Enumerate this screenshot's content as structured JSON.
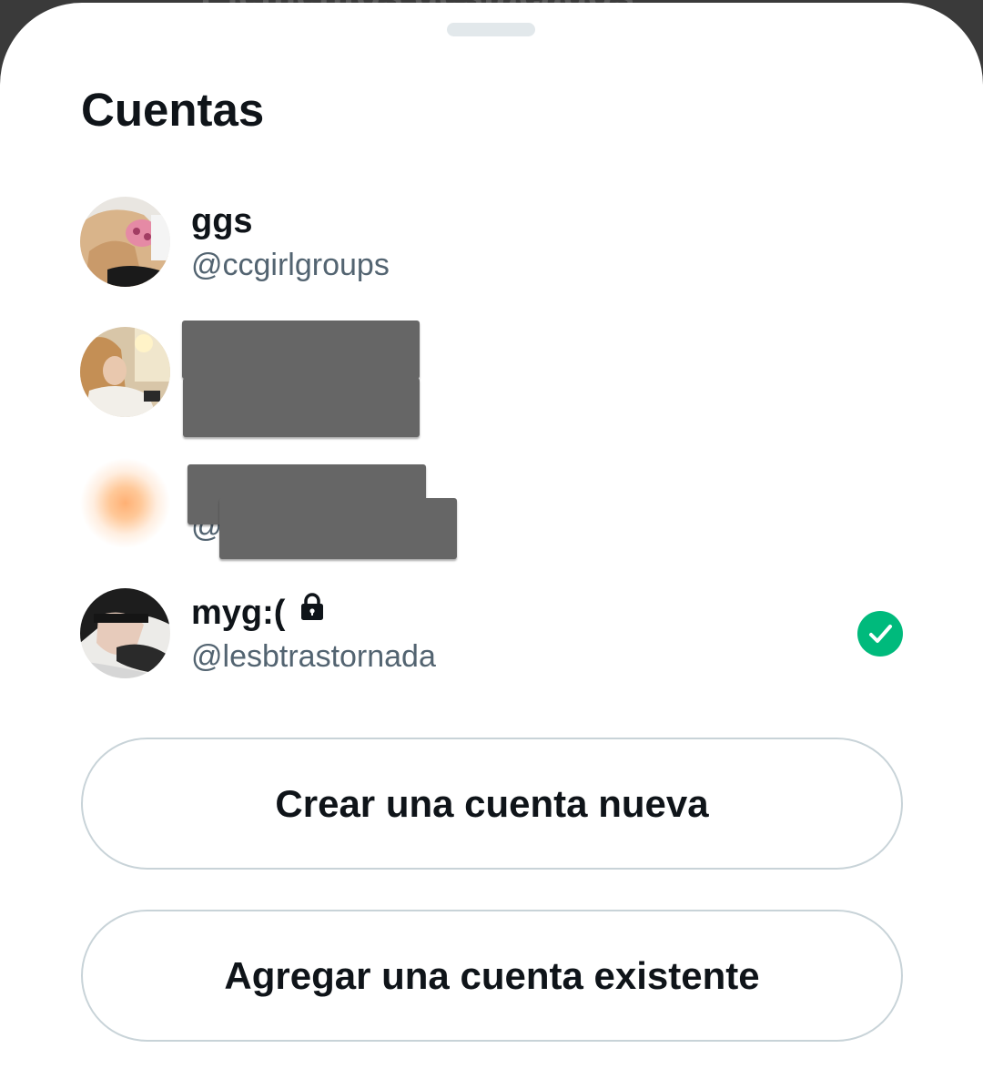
{
  "sheet": {
    "title": "Cuentas"
  },
  "accounts": [
    {
      "name": "ggs",
      "handle": "@ccgirlgroups",
      "redacted": false,
      "protected": false,
      "selected": false
    },
    {
      "name": "",
      "handle": "",
      "redacted": true,
      "protected": false,
      "selected": false
    },
    {
      "name": "",
      "handle": "@",
      "redacted": true,
      "protected": false,
      "selected": false
    },
    {
      "name": "myg:(",
      "handle": "@lesbtrastornada",
      "redacted": false,
      "protected": true,
      "selected": true,
      "status_icon": "check-circle-icon"
    }
  ],
  "actions": {
    "create_label": "Crear una cuenta nueva",
    "add_label": "Agregar una cuenta existente"
  },
  "colors": {
    "text_primary": "#0f1419",
    "text_secondary": "#536471",
    "selected_check": "#00ba7c",
    "button_border": "#c8d3d8",
    "redaction": "#666666"
  }
}
